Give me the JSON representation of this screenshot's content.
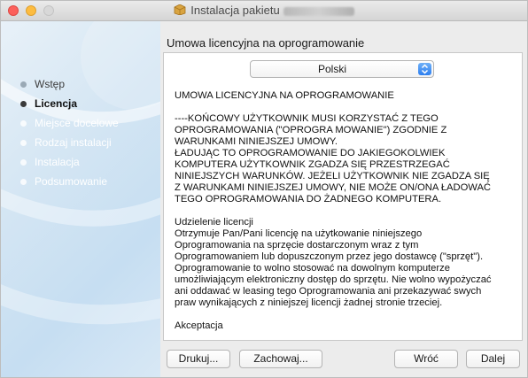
{
  "window": {
    "title_prefix": "Instalacja pakietu",
    "title_name": "",
    "traffic_lights": [
      "close",
      "minimize",
      "zoom"
    ]
  },
  "sidebar": {
    "steps": [
      {
        "label": "Wstęp",
        "state": "done"
      },
      {
        "label": "Licencja",
        "state": "active"
      },
      {
        "label": "Miejsce docelowe",
        "state": "future"
      },
      {
        "label": "Rodzaj instalacji",
        "state": "future"
      },
      {
        "label": "Instalacja",
        "state": "future"
      },
      {
        "label": "Podsumowanie",
        "state": "future"
      }
    ]
  },
  "main": {
    "heading": "Umowa licencyjna na oprogramowanie",
    "language": "Polski",
    "license_text": "UMOWA LICENCYJNA NA OPROGRAMOWANIE\n\n----KOŃCOWY UŻYTKOWNIK MUSI KORZYSTAĆ Z TEGO\nOPROGRAMOWANIA (\"OPROGRA MOWANIE\") ZGODNIE Z\nWARUNKAMI NINIEJSZEJ UMOWY.\nŁADUJĄC TO OPROGRAMOWANIE DO JAKIEGOKOLWIEK\nKOMPUTERA UŻYTKOWNIK ZGADZA SIĘ PRZESTRZEGAĆ\nNINIEJSZYCH WARUNKÓW. JEŻELI UŻYTKOWNIK NIE ZGADZA SIĘ\nZ WARUNKAMI NINIEJSZEJ UMOWY, NIE MOŻE ON/ONA ŁADOWAĆ\nTEGO OPROGRAMOWANIA DO ŻADNEGO KOMPUTERA.\n\nUdzielenie licencji\nOtrzymuje Pan/Pani licencję na użytkowanie niniejszego\nOprogramowania na sprzęcie dostarczonym wraz z tym\nOprogramowaniem lub dopuszczonym przez jego dostawcę (\"sprzęt\").\nOprogramowanie to wolno stosować na dowolnym komputerze\numożliwiającym elektroniczny dostęp do sprzętu. Nie wolno wypożyczać\nani oddawać w leasing tego Oprogramowania ani przekazywać swych\npraw wynikających z niniejszej licencji żadnej stronie trzeciej.\n\nAkceptacja"
  },
  "buttons": {
    "print": "Drukuj...",
    "save": "Zachowaj...",
    "back": "Wróć",
    "next": "Dalej"
  },
  "colors": {
    "accent": "#2d7ff0",
    "close": "#fc605b",
    "minimize": "#fdbc40"
  }
}
